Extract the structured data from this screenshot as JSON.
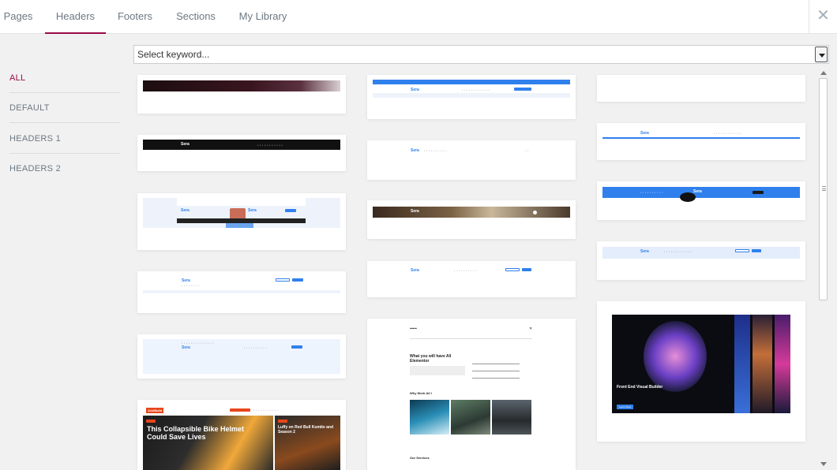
{
  "tabs": [
    {
      "label": "Pages"
    },
    {
      "label": "Headers"
    },
    {
      "label": "Footers"
    },
    {
      "label": "Sections"
    },
    {
      "label": "My Library"
    }
  ],
  "close_label": "✕",
  "categories": [
    {
      "label": "ALL"
    },
    {
      "label": "DEFAULT"
    },
    {
      "label": "HEADERS 1"
    },
    {
      "label": "HEADERS 2"
    }
  ],
  "search": {
    "placeholder": "Select keyword..."
  },
  "thumbs": {
    "logo": "Sera",
    "bike_title": "This Collapsible Bike Helmet Could Save Lives",
    "anime_title": "Luffy on Red Bull Kumite and Season 2",
    "brand_badge": "JoinBuild",
    "section_heading": "What you will have All Elementor",
    "why_work": "Why Work All I",
    "our_services": "Our Services",
    "art_title": "Front End Visual Builder",
    "art_button": "Learn More"
  },
  "colors": {
    "accent": "#9b0a46",
    "blue": "#2f80ed"
  }
}
